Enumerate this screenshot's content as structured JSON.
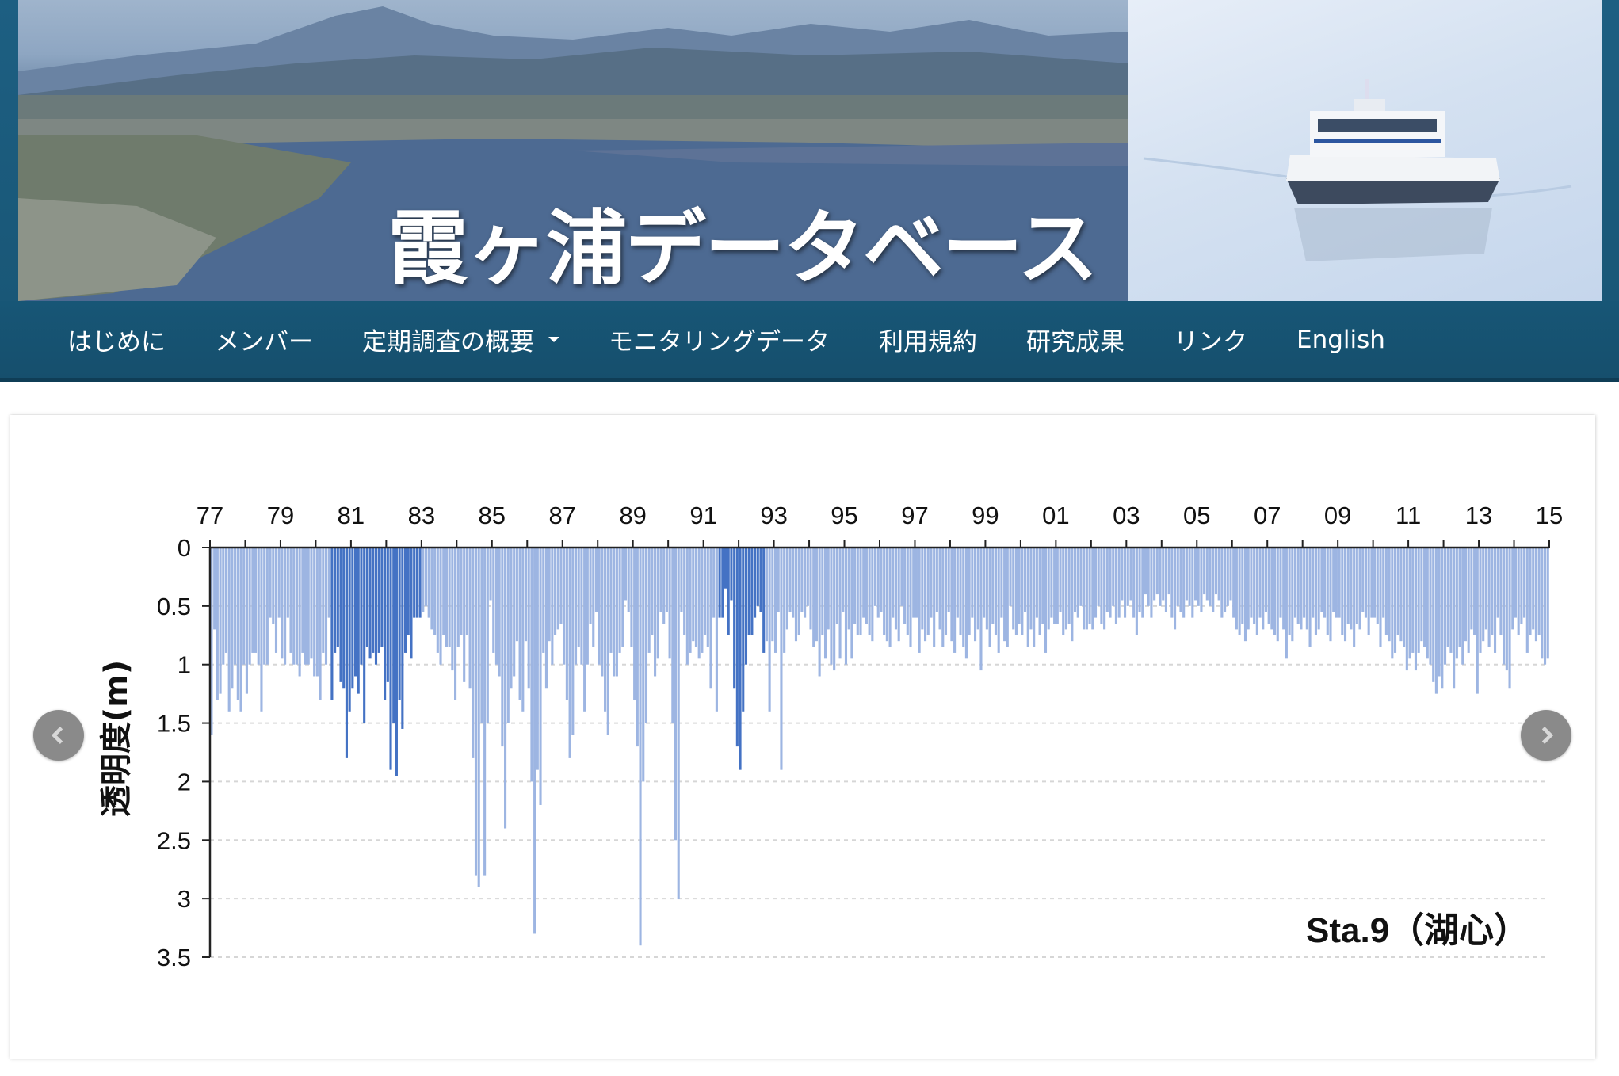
{
  "header": {
    "site_title": "霞ヶ浦データベース"
  },
  "nav": {
    "items": [
      {
        "label": "はじめに"
      },
      {
        "label": "メンバー"
      },
      {
        "label": "定期調査の概要",
        "has_dropdown": true
      },
      {
        "label": "モニタリングデータ"
      },
      {
        "label": "利用規約"
      },
      {
        "label": "研究成果"
      },
      {
        "label": "リンク"
      },
      {
        "label": "English"
      }
    ]
  },
  "carousel": {
    "prev_icon": "chevron-left-icon",
    "next_icon": "chevron-right-icon"
  },
  "colors": {
    "nav_bg": "#175676",
    "bar": "#9db5e2",
    "bar_highlight": "#4472c4"
  },
  "chart_data": {
    "type": "bar",
    "orientation": "inverted-vertical",
    "ylabel": "透明度(m)",
    "annotation": "Sta.9（湖心）",
    "ylim": [
      0,
      3.5
    ],
    "y_inverted": true,
    "y_ticks": [
      "0",
      "0.5",
      "1",
      "1.5",
      "2",
      "2.5",
      "3",
      "3.5"
    ],
    "x_axis_position": "top",
    "x_range_years": [
      1977,
      2015
    ],
    "x_tick_labels": [
      "77",
      "79",
      "81",
      "83",
      "85",
      "87",
      "89",
      "91",
      "93",
      "95",
      "97",
      "99",
      "01",
      "03",
      "05",
      "07",
      "09",
      "11",
      "13",
      "15"
    ],
    "grid": "horizontal dashed",
    "highlight_periods": [
      [
        "1980-06",
        "1983-01"
      ],
      [
        "1991-06",
        "1992-10"
      ]
    ],
    "series": [
      {
        "interval": "monthly",
        "start": "1977-01",
        "values_by_year": {
          "1977": [
            1.6,
            0.7,
            1.3,
            1.25,
            1.0,
            0.9,
            1.4,
            1.2,
            1.0,
            1.3,
            1.4,
            1.0
          ],
          "1978": [
            1.25,
            1.0,
            0.9,
            0.9,
            1.0,
            1.4,
            1.0,
            1.0,
            0.6,
            0.65,
            0.9,
            0.6
          ],
          "1979": [
            0.95,
            1.0,
            0.6,
            0.9,
            1.0,
            1.0,
            1.1,
            0.9,
            1.0,
            1.0,
            0.95,
            1.1
          ],
          "1980": [
            1.1,
            1.3,
            0.9,
            1.0,
            0.6,
            1.3,
            0.9,
            0.85,
            1.15,
            1.2,
            1.8,
            1.4
          ],
          "1981": [
            1.2,
            1.1,
            1.25,
            1.0,
            1.5,
            0.85,
            0.95,
            0.9,
            1.0,
            0.9,
            0.85,
            1.3
          ],
          "1982": [
            1.15,
            1.9,
            1.5,
            1.95,
            1.3,
            1.55,
            0.9,
            0.75,
            0.95,
            0.6,
            0.6,
            0.6
          ],
          "1983": [
            0.55,
            0.5,
            0.6,
            0.7,
            0.75,
            0.9,
            1.0,
            0.75,
            0.85,
            0.85,
            1.05,
            1.3
          ],
          "1984": [
            0.85,
            0.75,
            1.15,
            0.75,
            1.2,
            1.8,
            2.8,
            2.9,
            1.5,
            2.8,
            1.5,
            0.45
          ],
          "1985": [
            0.9,
            1.0,
            1.1,
            1.7,
            2.4,
            1.5,
            1.2,
            1.1,
            0.8,
            1.3,
            1.4,
            0.8
          ],
          "1986": [
            1.2,
            2.0,
            3.3,
            1.9,
            2.2,
            0.9,
            1.2,
            0.8,
            1.0,
            0.75,
            0.7,
            0.65
          ],
          "1987": [
            1.0,
            1.3,
            1.8,
            1.6,
            1.0,
            0.85,
            1.0,
            1.4,
            1.0,
            0.65,
            0.85,
            0.55
          ],
          "1988": [
            1.0,
            1.1,
            1.4,
            1.6,
            0.9,
            1.1,
            1.1,
            0.9,
            0.85,
            0.45,
            0.55,
            0.85
          ],
          "1989": [
            1.3,
            1.7,
            3.4,
            2.0,
            1.5,
            0.9,
            0.75,
            1.1,
            0.95,
            0.55,
            0.65,
            0.55
          ],
          "1990": [
            0.95,
            1.5,
            2.5,
            3.0,
            0.55,
            0.75,
            1.0,
            0.9,
            0.8,
            0.85,
            0.95,
            0.9
          ],
          "1991": [
            0.75,
            0.85,
            1.2,
            0.6,
            1.4,
            0.6,
            0.6,
            0.35,
            0.75,
            0.45,
            1.2,
            1.7
          ],
          "1992": [
            1.9,
            1.4,
            1.0,
            0.75,
            0.75,
            0.6,
            0.5,
            0.55,
            0.9,
            0.8,
            1.4,
            0.8
          ],
          "1993": [
            0.9,
            0.55,
            1.9,
            0.9,
            0.7,
            0.55,
            0.6,
            0.8,
            0.75,
            0.55,
            0.6,
            0.5
          ],
          "1994": [
            0.7,
            0.85,
            0.8,
            1.1,
            0.75,
            0.95,
            0.7,
            1.0,
            1.05,
            0.65,
            0.95,
            0.55
          ],
          "1995": [
            1.0,
            0.7,
            0.95,
            0.65,
            0.75,
            0.75,
            0.6,
            0.65,
            0.75,
            0.8,
            0.5,
            0.6
          ],
          "1996": [
            0.55,
            0.75,
            0.8,
            0.85,
            0.6,
            0.7,
            0.8,
            0.5,
            0.65,
            0.75,
            0.85,
            0.6
          ],
          "1997": [
            0.6,
            0.9,
            0.7,
            0.8,
            0.75,
            0.6,
            0.85,
            0.55,
            0.7,
            0.85,
            0.75,
            0.55
          ],
          "1998": [
            0.8,
            0.9,
            0.6,
            0.75,
            0.85,
            0.95,
            0.75,
            0.6,
            0.8,
            0.7,
            1.05,
            0.6
          ],
          "1999": [
            0.7,
            0.85,
            0.65,
            0.75,
            0.9,
            0.6,
            0.8,
            0.85,
            0.5,
            0.7,
            0.75,
            0.65
          ],
          "2000": [
            0.75,
            0.55,
            0.85,
            0.7,
            0.85,
            0.6,
            0.75,
            0.65,
            0.9,
            0.7,
            0.6,
            0.65
          ],
          "2001": [
            0.65,
            0.55,
            0.75,
            0.7,
            0.65,
            0.8,
            0.55,
            0.6,
            0.5,
            0.7,
            0.7,
            0.65
          ],
          "2002": [
            0.7,
            0.6,
            0.5,
            0.65,
            0.7,
            0.55,
            0.6,
            0.5,
            0.65,
            0.6,
            0.45,
            0.6
          ],
          "2003": [
            0.5,
            0.45,
            0.6,
            0.75,
            0.55,
            0.6,
            0.4,
            0.5,
            0.6,
            0.45,
            0.4,
            0.5
          ],
          "2004": [
            0.45,
            0.55,
            0.4,
            0.6,
            0.7,
            0.5,
            0.55,
            0.6,
            0.45,
            0.5,
            0.6,
            0.45
          ],
          "2005": [
            0.5,
            0.55,
            0.4,
            0.45,
            0.5,
            0.55,
            0.4,
            0.45,
            0.6,
            0.55,
            0.5,
            0.45
          ],
          "2006": [
            0.6,
            0.7,
            0.75,
            0.65,
            0.8,
            0.7,
            0.6,
            0.65,
            0.75,
            0.6,
            0.7,
            0.55
          ],
          "2007": [
            0.65,
            0.7,
            0.75,
            0.8,
            0.6,
            0.7,
            0.95,
            0.75,
            0.8,
            0.6,
            0.65,
            0.7
          ],
          "2008": [
            0.6,
            0.7,
            0.85,
            0.6,
            0.75,
            0.7,
            0.55,
            0.6,
            0.75,
            0.8,
            0.55,
            0.6
          ],
          "2009": [
            0.6,
            0.75,
            0.8,
            0.65,
            0.7,
            0.85,
            0.65,
            0.7,
            0.55,
            0.6,
            0.75,
            0.6
          ],
          "2010": [
            0.6,
            0.65,
            0.85,
            0.6,
            0.75,
            0.8,
            0.95,
            0.9,
            0.75,
            0.8,
            0.85,
            1.05
          ],
          "2011": [
            0.95,
            0.9,
            1.05,
            0.9,
            0.8,
            0.85,
            0.95,
            1.0,
            1.15,
            1.25,
            1.1,
            1.2
          ],
          "2012": [
            1.0,
            0.85,
            0.9,
            1.2,
            0.95,
            0.85,
            1.0,
            0.8,
            0.9,
            0.7,
            0.75,
            1.25
          ],
          "2013": [
            0.9,
            0.8,
            0.7,
            0.85,
            0.75,
            0.9,
            0.6,
            0.75,
            1.0,
            1.05,
            1.2,
            0.7
          ],
          "2014": [
            0.6,
            0.75,
            0.65,
            0.6,
            0.9,
            0.75,
            0.7,
            0.8,
            0.75,
            0.95,
            1.0,
            0.95
          ]
        }
      }
    ]
  }
}
